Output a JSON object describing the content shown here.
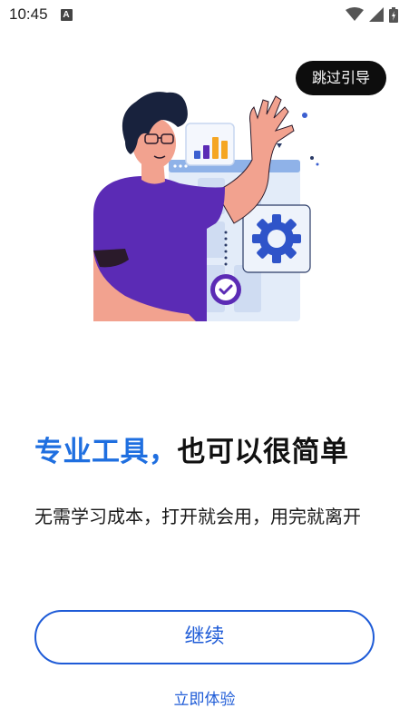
{
  "status_bar": {
    "time": "10:45",
    "notification_icon": "A",
    "icons": [
      "wifi-icon",
      "signal-icon",
      "battery-icon"
    ]
  },
  "skip_button": {
    "label": "跳过引导"
  },
  "illustration": {
    "description_icons": [
      "bar-chart-icon",
      "gear-icon",
      "check-icon"
    ],
    "colors": {
      "shirt": "#5b2bb5",
      "panel": "#dce7f7",
      "gear": "#2f54c9",
      "chart_blue": "#3b5fd0",
      "chart_purple": "#5b2bb5",
      "chart_orange": "#f5a623"
    }
  },
  "headline": {
    "accent": "专业工具，",
    "rest": "也可以很简单"
  },
  "subtitle": "无需学习成本，打开就会用，用完就离开",
  "continue_button": {
    "label": "继续"
  },
  "try_link": {
    "label": "立即体验"
  },
  "colors": {
    "accent": "#1f6fe0",
    "button": "#1e5bd7"
  }
}
